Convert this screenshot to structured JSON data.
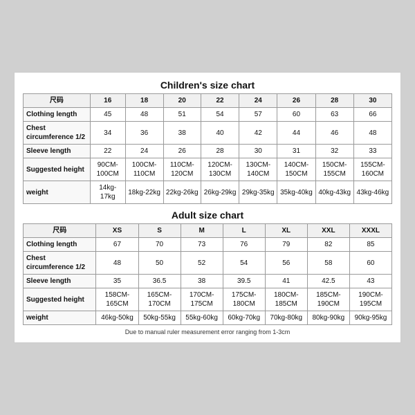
{
  "children_chart": {
    "title": "Children's size chart",
    "columns": [
      "尺码",
      "16",
      "18",
      "20",
      "22",
      "24",
      "26",
      "28",
      "30"
    ],
    "rows": [
      {
        "label": "Clothing length",
        "values": [
          "45",
          "48",
          "51",
          "54",
          "57",
          "60",
          "63",
          "66"
        ]
      },
      {
        "label": "Chest circumference 1/2",
        "values": [
          "34",
          "36",
          "38",
          "40",
          "42",
          "44",
          "46",
          "48"
        ]
      },
      {
        "label": "Sleeve length",
        "values": [
          "22",
          "24",
          "26",
          "28",
          "30",
          "31",
          "32",
          "33"
        ]
      },
      {
        "label": "Suggested height",
        "values": [
          "90CM-100CM",
          "100CM-110CM",
          "110CM-120CM",
          "120CM-130CM",
          "130CM-140CM",
          "140CM-150CM",
          "150CM-155CM",
          "155CM-160CM"
        ]
      },
      {
        "label": "weight",
        "values": [
          "14kg-17kg",
          "18kg-22kg",
          "22kg-26kg",
          "26kg-29kg",
          "29kg-35kg",
          "35kg-40kg",
          "40kg-43kg",
          "43kg-46kg"
        ]
      }
    ]
  },
  "adult_chart": {
    "title": "Adult size chart",
    "columns": [
      "尺码",
      "XS",
      "S",
      "M",
      "L",
      "XL",
      "XXL",
      "XXXL"
    ],
    "rows": [
      {
        "label": "Clothing length",
        "values": [
          "67",
          "70",
          "73",
          "76",
          "79",
          "82",
          "85"
        ]
      },
      {
        "label": "Chest circumference 1/2",
        "values": [
          "48",
          "50",
          "52",
          "54",
          "56",
          "58",
          "60"
        ]
      },
      {
        "label": "Sleeve length",
        "values": [
          "35",
          "36.5",
          "38",
          "39.5",
          "41",
          "42.5",
          "43"
        ]
      },
      {
        "label": "Suggested height",
        "values": [
          "158CM-165CM",
          "165CM-170CM",
          "170CM-175CM",
          "175CM-180CM",
          "180CM-185CM",
          "185CM-190CM",
          "190CM-195CM"
        ]
      },
      {
        "label": "weight",
        "values": [
          "46kg-50kg",
          "50kg-55kg",
          "55kg-60kg",
          "60kg-70kg",
          "70kg-80kg",
          "80kg-90kg",
          "90kg-95kg"
        ]
      }
    ]
  },
  "note": "Due to manual ruler measurement error ranging from 1-3cm"
}
